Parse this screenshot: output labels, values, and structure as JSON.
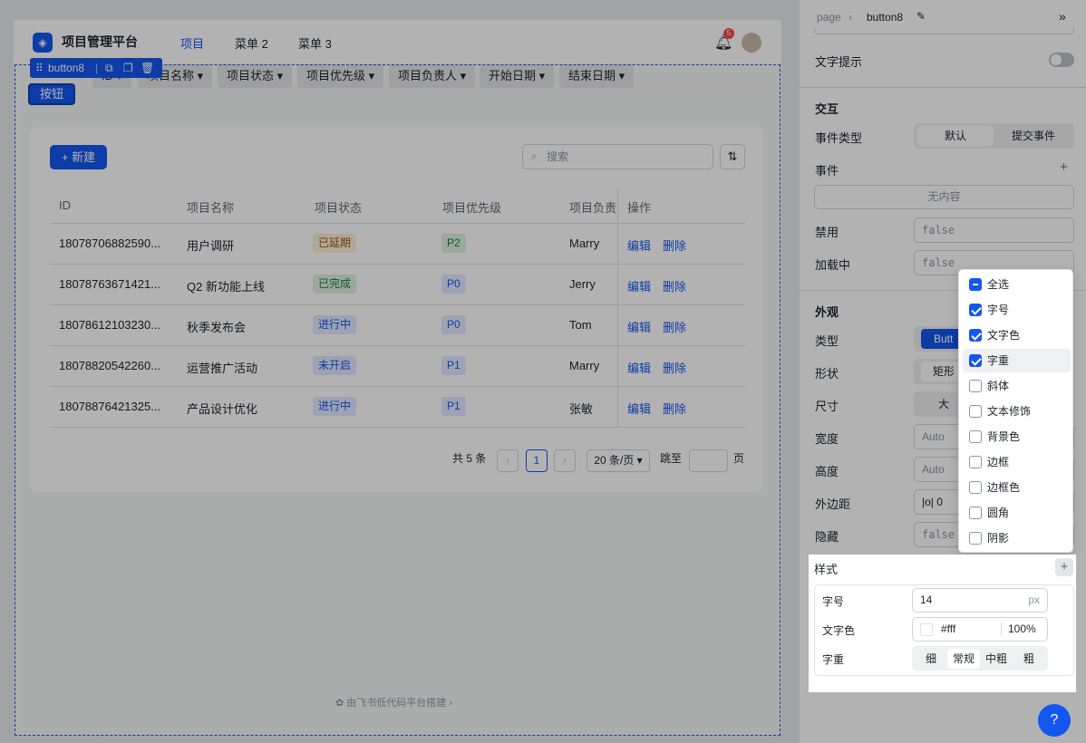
{
  "app": {
    "brand": "项目管理平台",
    "nav": [
      "项目",
      "菜单 2",
      "菜单 3"
    ],
    "notification_count": "5"
  },
  "selection": {
    "label": "button8",
    "button_text": "按钮"
  },
  "filters": [
    "ID",
    "项目名称",
    "项目状态",
    "项目优先级",
    "项目负责人",
    "开始日期",
    "结束日期"
  ],
  "toolbar": {
    "new_label": "+ 新建",
    "search_placeholder": "搜索"
  },
  "table": {
    "headers": [
      "ID",
      "项目名称",
      "项目状态",
      "项目优先级",
      "项目负责人",
      "操作"
    ],
    "rows": [
      {
        "id": "18078706882590...",
        "name": "用户调研",
        "status": "已延期",
        "priority": "P2",
        "owner": "Marry",
        "edit": "编辑",
        "del": "删除"
      },
      {
        "id": "18078763671421...",
        "name": "Q2 新功能上线",
        "status": "已完成",
        "priority": "P0",
        "owner": "Jerry",
        "edit": "编辑",
        "del": "删除"
      },
      {
        "id": "18078612103230...",
        "name": "秋季发布会",
        "status": "进行中",
        "priority": "P0",
        "owner": "Tom",
        "edit": "编辑",
        "del": "删除"
      },
      {
        "id": "18078820542260...",
        "name": "运营推广活动",
        "status": "未开启",
        "priority": "P1",
        "owner": "Marry",
        "edit": "编辑",
        "del": "删除"
      },
      {
        "id": "18078876421325...",
        "name": "产品设计优化",
        "status": "进行中",
        "priority": "P1",
        "owner": "张敏",
        "edit": "编辑",
        "del": "删除"
      }
    ]
  },
  "pagination": {
    "total": "共 5 条",
    "current": "1",
    "page_size": "20 条/页",
    "jump_label": "跳至",
    "page_unit": "页"
  },
  "footer": "由飞书低代码平台搭建",
  "panel": {
    "breadcrumb_root": "page",
    "breadcrumb_current": "button8",
    "tooltip_label": "文字提示",
    "interaction_title": "交互",
    "event_type_label": "事件类型",
    "event_type_options": [
      "默认",
      "提交事件"
    ],
    "events_label": "事件",
    "events_empty": "无内容",
    "disabled_label": "禁用",
    "disabled_value": "false",
    "loading_label": "加载中",
    "loading_value": "false",
    "appearance_title": "外观",
    "type_label": "类型",
    "type_value": "Butt",
    "shape_label": "形状",
    "shape_value": "矩形",
    "size_label": "尺寸",
    "size_value": "大",
    "width_label": "宽度",
    "width_value": "Auto",
    "height_label": "高度",
    "height_value": "Auto",
    "margin_label": "外边距",
    "margin_value": "|o| 0",
    "hidden_label": "隐藏",
    "hidden_value": "false"
  },
  "dropdown": [
    {
      "label": "全选",
      "state": "indeterminate"
    },
    {
      "label": "字号",
      "state": "checked"
    },
    {
      "label": "文字色",
      "state": "checked"
    },
    {
      "label": "字重",
      "state": "checked"
    },
    {
      "label": "斜体",
      "state": "unchecked"
    },
    {
      "label": "文本修饰",
      "state": "unchecked"
    },
    {
      "label": "背景色",
      "state": "unchecked"
    },
    {
      "label": "边框",
      "state": "unchecked"
    },
    {
      "label": "边框色",
      "state": "unchecked"
    },
    {
      "label": "圆角",
      "state": "unchecked"
    },
    {
      "label": "阴影",
      "state": "unchecked"
    }
  ],
  "style": {
    "title": "样式",
    "font_size_label": "字号",
    "font_size_value": "14",
    "font_size_unit": "px",
    "color_label": "文字色",
    "color_value": "#fff",
    "color_opacity": "100%",
    "weight_label": "字重",
    "weight_options": [
      "细",
      "常规",
      "中粗",
      "粗"
    ]
  },
  "colors": {
    "accent": "#1456f0",
    "delayed_bg": "#fdf0d8",
    "done_bg": "#dcf3df",
    "progress_bg": "#e1eaff",
    "priority_p2_bg": "#dcf3df",
    "priority_bg": "#e1eaff"
  }
}
